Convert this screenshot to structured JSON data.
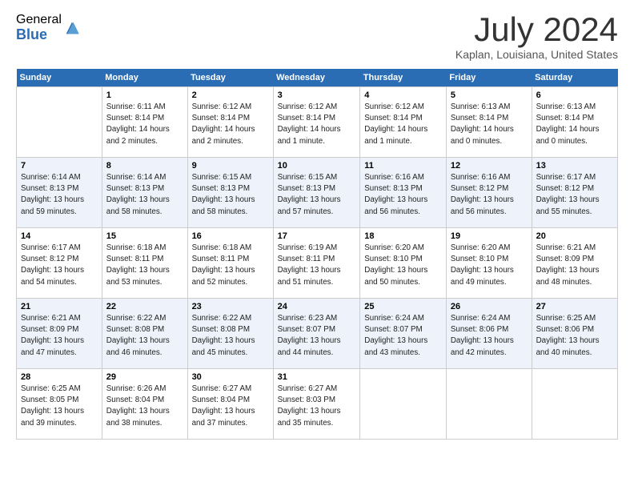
{
  "logo": {
    "general": "General",
    "blue": "Blue"
  },
  "title": "July 2024",
  "location": "Kaplan, Louisiana, United States",
  "weekdays": [
    "Sunday",
    "Monday",
    "Tuesday",
    "Wednesday",
    "Thursday",
    "Friday",
    "Saturday"
  ],
  "weeks": [
    [
      {
        "day": "",
        "sunrise": "",
        "sunset": "",
        "daylight": ""
      },
      {
        "day": "1",
        "sunrise": "Sunrise: 6:11 AM",
        "sunset": "Sunset: 8:14 PM",
        "daylight": "Daylight: 14 hours and 2 minutes."
      },
      {
        "day": "2",
        "sunrise": "Sunrise: 6:12 AM",
        "sunset": "Sunset: 8:14 PM",
        "daylight": "Daylight: 14 hours and 2 minutes."
      },
      {
        "day": "3",
        "sunrise": "Sunrise: 6:12 AM",
        "sunset": "Sunset: 8:14 PM",
        "daylight": "Daylight: 14 hours and 1 minute."
      },
      {
        "day": "4",
        "sunrise": "Sunrise: 6:12 AM",
        "sunset": "Sunset: 8:14 PM",
        "daylight": "Daylight: 14 hours and 1 minute."
      },
      {
        "day": "5",
        "sunrise": "Sunrise: 6:13 AM",
        "sunset": "Sunset: 8:14 PM",
        "daylight": "Daylight: 14 hours and 0 minutes."
      },
      {
        "day": "6",
        "sunrise": "Sunrise: 6:13 AM",
        "sunset": "Sunset: 8:14 PM",
        "daylight": "Daylight: 14 hours and 0 minutes."
      }
    ],
    [
      {
        "day": "7",
        "sunrise": "Sunrise: 6:14 AM",
        "sunset": "Sunset: 8:13 PM",
        "daylight": "Daylight: 13 hours and 59 minutes."
      },
      {
        "day": "8",
        "sunrise": "Sunrise: 6:14 AM",
        "sunset": "Sunset: 8:13 PM",
        "daylight": "Daylight: 13 hours and 58 minutes."
      },
      {
        "day": "9",
        "sunrise": "Sunrise: 6:15 AM",
        "sunset": "Sunset: 8:13 PM",
        "daylight": "Daylight: 13 hours and 58 minutes."
      },
      {
        "day": "10",
        "sunrise": "Sunrise: 6:15 AM",
        "sunset": "Sunset: 8:13 PM",
        "daylight": "Daylight: 13 hours and 57 minutes."
      },
      {
        "day": "11",
        "sunrise": "Sunrise: 6:16 AM",
        "sunset": "Sunset: 8:13 PM",
        "daylight": "Daylight: 13 hours and 56 minutes."
      },
      {
        "day": "12",
        "sunrise": "Sunrise: 6:16 AM",
        "sunset": "Sunset: 8:12 PM",
        "daylight": "Daylight: 13 hours and 56 minutes."
      },
      {
        "day": "13",
        "sunrise": "Sunrise: 6:17 AM",
        "sunset": "Sunset: 8:12 PM",
        "daylight": "Daylight: 13 hours and 55 minutes."
      }
    ],
    [
      {
        "day": "14",
        "sunrise": "Sunrise: 6:17 AM",
        "sunset": "Sunset: 8:12 PM",
        "daylight": "Daylight: 13 hours and 54 minutes."
      },
      {
        "day": "15",
        "sunrise": "Sunrise: 6:18 AM",
        "sunset": "Sunset: 8:11 PM",
        "daylight": "Daylight: 13 hours and 53 minutes."
      },
      {
        "day": "16",
        "sunrise": "Sunrise: 6:18 AM",
        "sunset": "Sunset: 8:11 PM",
        "daylight": "Daylight: 13 hours and 52 minutes."
      },
      {
        "day": "17",
        "sunrise": "Sunrise: 6:19 AM",
        "sunset": "Sunset: 8:11 PM",
        "daylight": "Daylight: 13 hours and 51 minutes."
      },
      {
        "day": "18",
        "sunrise": "Sunrise: 6:20 AM",
        "sunset": "Sunset: 8:10 PM",
        "daylight": "Daylight: 13 hours and 50 minutes."
      },
      {
        "day": "19",
        "sunrise": "Sunrise: 6:20 AM",
        "sunset": "Sunset: 8:10 PM",
        "daylight": "Daylight: 13 hours and 49 minutes."
      },
      {
        "day": "20",
        "sunrise": "Sunrise: 6:21 AM",
        "sunset": "Sunset: 8:09 PM",
        "daylight": "Daylight: 13 hours and 48 minutes."
      }
    ],
    [
      {
        "day": "21",
        "sunrise": "Sunrise: 6:21 AM",
        "sunset": "Sunset: 8:09 PM",
        "daylight": "Daylight: 13 hours and 47 minutes."
      },
      {
        "day": "22",
        "sunrise": "Sunrise: 6:22 AM",
        "sunset": "Sunset: 8:08 PM",
        "daylight": "Daylight: 13 hours and 46 minutes."
      },
      {
        "day": "23",
        "sunrise": "Sunrise: 6:22 AM",
        "sunset": "Sunset: 8:08 PM",
        "daylight": "Daylight: 13 hours and 45 minutes."
      },
      {
        "day": "24",
        "sunrise": "Sunrise: 6:23 AM",
        "sunset": "Sunset: 8:07 PM",
        "daylight": "Daylight: 13 hours and 44 minutes."
      },
      {
        "day": "25",
        "sunrise": "Sunrise: 6:24 AM",
        "sunset": "Sunset: 8:07 PM",
        "daylight": "Daylight: 13 hours and 43 minutes."
      },
      {
        "day": "26",
        "sunrise": "Sunrise: 6:24 AM",
        "sunset": "Sunset: 8:06 PM",
        "daylight": "Daylight: 13 hours and 42 minutes."
      },
      {
        "day": "27",
        "sunrise": "Sunrise: 6:25 AM",
        "sunset": "Sunset: 8:06 PM",
        "daylight": "Daylight: 13 hours and 40 minutes."
      }
    ],
    [
      {
        "day": "28",
        "sunrise": "Sunrise: 6:25 AM",
        "sunset": "Sunset: 8:05 PM",
        "daylight": "Daylight: 13 hours and 39 minutes."
      },
      {
        "day": "29",
        "sunrise": "Sunrise: 6:26 AM",
        "sunset": "Sunset: 8:04 PM",
        "daylight": "Daylight: 13 hours and 38 minutes."
      },
      {
        "day": "30",
        "sunrise": "Sunrise: 6:27 AM",
        "sunset": "Sunset: 8:04 PM",
        "daylight": "Daylight: 13 hours and 37 minutes."
      },
      {
        "day": "31",
        "sunrise": "Sunrise: 6:27 AM",
        "sunset": "Sunset: 8:03 PM",
        "daylight": "Daylight: 13 hours and 35 minutes."
      },
      {
        "day": "",
        "sunrise": "",
        "sunset": "",
        "daylight": ""
      },
      {
        "day": "",
        "sunrise": "",
        "sunset": "",
        "daylight": ""
      },
      {
        "day": "",
        "sunrise": "",
        "sunset": "",
        "daylight": ""
      }
    ]
  ]
}
